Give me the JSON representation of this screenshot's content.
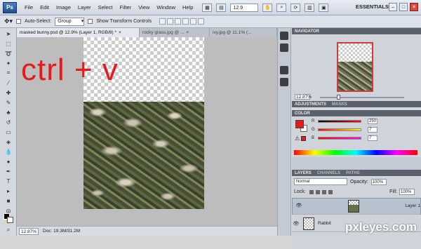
{
  "menubar": {
    "logo": "Ps",
    "menus": [
      "File",
      "Edit",
      "Image",
      "Layer",
      "Select",
      "Filter",
      "View",
      "Window",
      "Help"
    ],
    "zoom": "12.9",
    "workspace": "ESSENTIALS",
    "win_min": "–",
    "win_max": "□",
    "win_close": "✕"
  },
  "options": {
    "auto_select_label": "Auto-Select:",
    "auto_select_value": "Group",
    "show_transform_label": "Show Transform Controls"
  },
  "tabs": [
    {
      "label": "masked bunny.psd @ 12.9% (Layer 1, RGB/8) *"
    },
    {
      "label": "rocky grass.jpg @ ..."
    },
    {
      "label": "ivy.jpg @ 11.1% (..."
    }
  ],
  "tab_close": "×",
  "canvas": {
    "annotation": "ctrl + v"
  },
  "status": {
    "zoom": "12.87%",
    "doc": "Doc: 19.3M/31.2M"
  },
  "navigator": {
    "title": "NAVIGATOR",
    "zoom": "12.87%"
  },
  "adjustments": {
    "title": "ADJUSTMENTS",
    "tab2": "MASKS"
  },
  "color": {
    "title": "COLOR",
    "r_label": "R",
    "r_value": "250",
    "g_label": "G",
    "g_value": "7",
    "b_label": "B",
    "b_value": "7",
    "fg_color": "#fa0707"
  },
  "layers": {
    "title": "LAYERS",
    "tab_channels": "CHANNELS",
    "tab_paths": "PATHS",
    "blend_mode": "Normal",
    "opacity_label": "Opacity:",
    "opacity_value": "100%",
    "lock_label": "Lock:",
    "fill_label": "Fill:",
    "fill_value": "100%",
    "items": [
      {
        "name": "Layer 1",
        "selected": true
      },
      {
        "name": "Rabbit",
        "selected": false
      }
    ]
  },
  "watermark": "pxleyes.com"
}
